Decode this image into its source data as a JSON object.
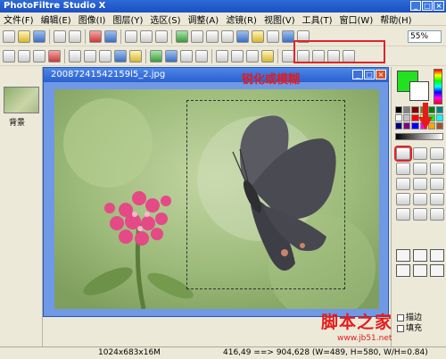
{
  "app": {
    "title": "PhotoFiltre Studio X"
  },
  "menu": [
    "文件(F)",
    "编辑(E)",
    "图像(I)",
    "图层(Y)",
    "选区(S)",
    "调整(A)",
    "滤镜(R)",
    "视图(V)",
    "工具(T)",
    "窗口(W)",
    "帮助(H)"
  ],
  "toolbar": {
    "zoom": "55%"
  },
  "layers": {
    "background_label": "背景"
  },
  "document": {
    "title": "20087241542159l5_2.jpg",
    "annotation": "锐化或模糊"
  },
  "right_panel": {
    "fg_color": "#22e022",
    "bg_color": "#ffffff",
    "option_1": "描边",
    "option_2": "填充"
  },
  "status": {
    "size": "1024x683x16M",
    "coords": "416,49 ==> 904,628 (W=489, H=580, W/H=0.84)"
  },
  "watermark": {
    "text": "脚本之家",
    "url": "www.jb51.net"
  }
}
